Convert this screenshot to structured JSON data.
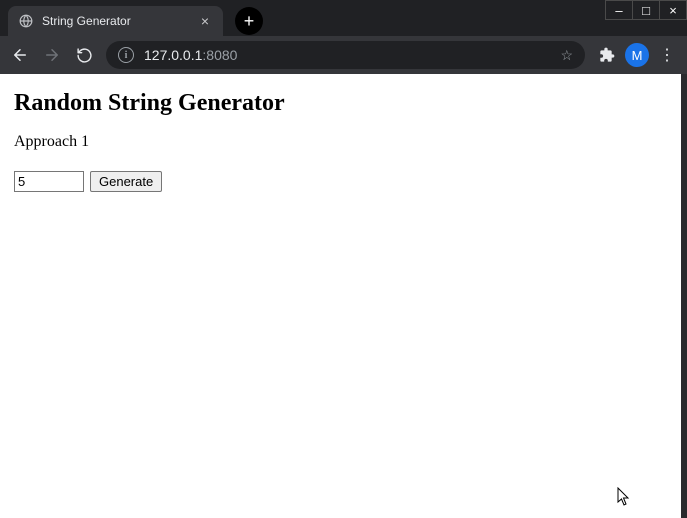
{
  "window": {
    "minimize_glyph": "–",
    "maximize_glyph": "□",
    "close_glyph": "×"
  },
  "browser": {
    "tab": {
      "title": "String Generator",
      "close_glyph": "×"
    },
    "new_tab_glyph": "+",
    "nav": {
      "back_glyph": "←",
      "forward_glyph": "→"
    },
    "address": {
      "info_glyph": "i",
      "host": "127.0.0.1",
      "port_suffix": ":8080",
      "star_glyph": "☆"
    },
    "profile_initial": "M",
    "menu_glyph": "⋮"
  },
  "page": {
    "heading": "Random String Generator",
    "subtitle": "Approach 1",
    "input_value": "5",
    "generate_label": "Generate"
  }
}
